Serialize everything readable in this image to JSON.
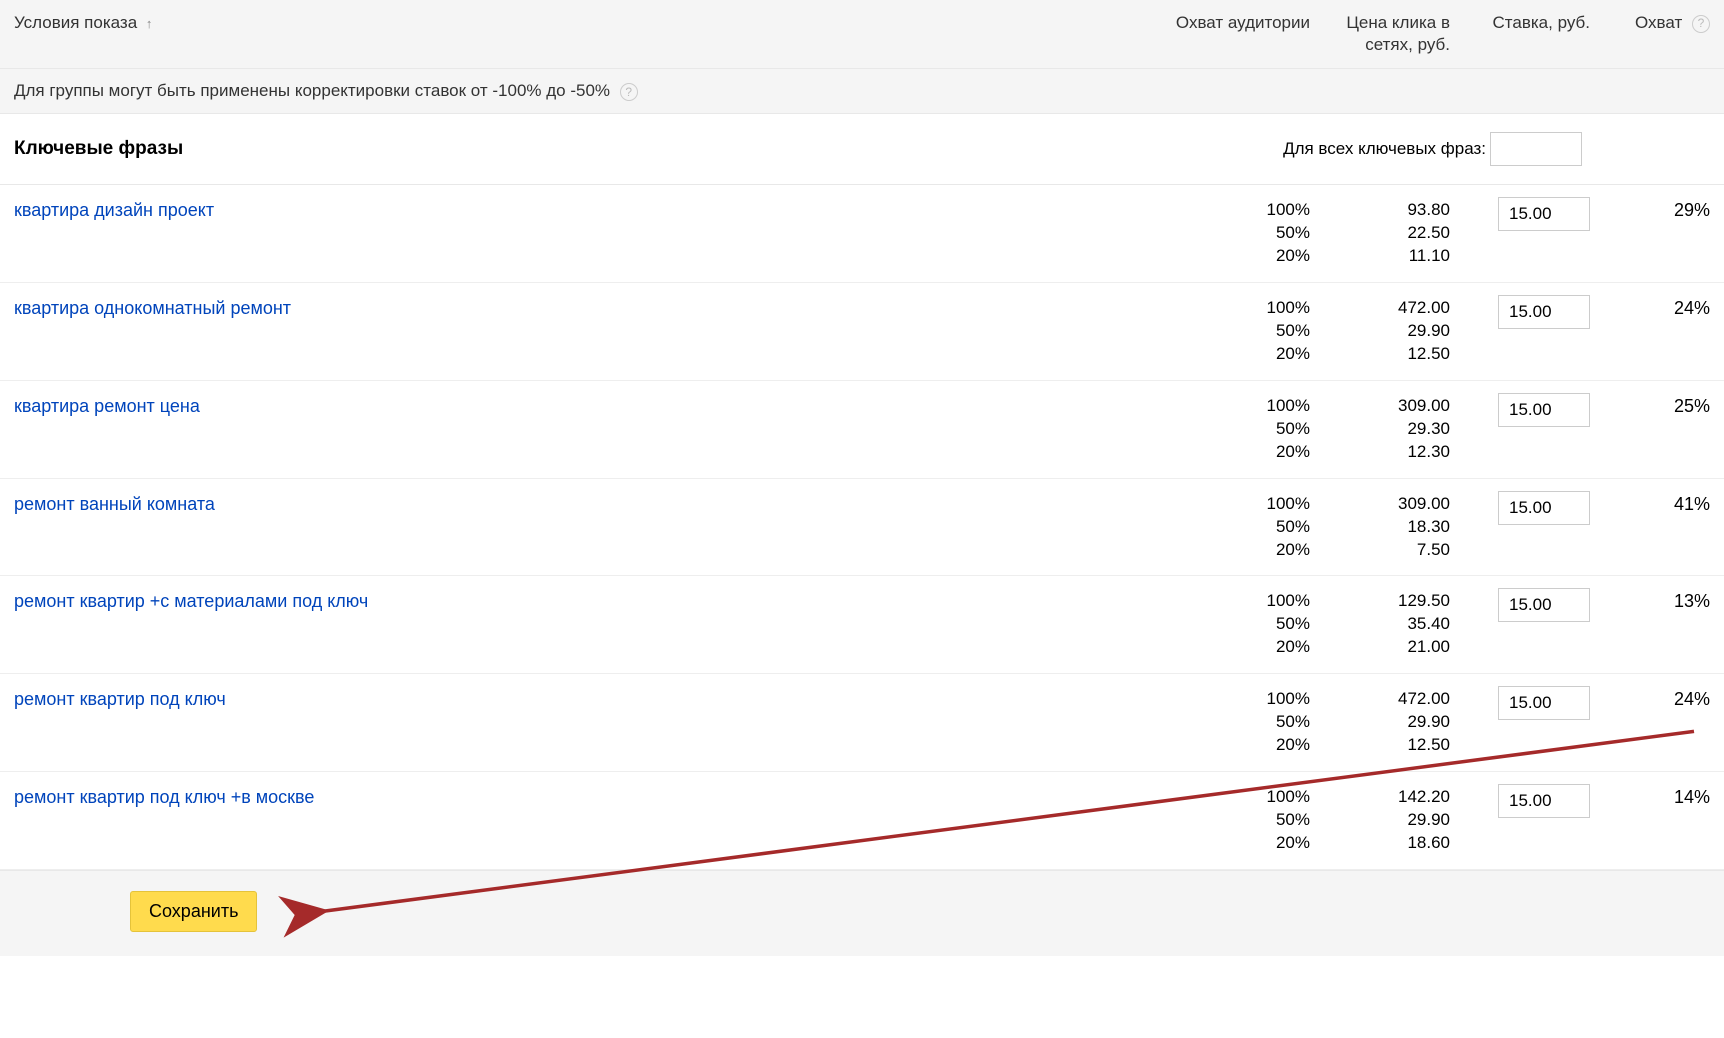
{
  "headers": {
    "conditions": "Условия показа",
    "audience_reach": "Охват аудитории",
    "click_price": "Цена клика в сетях, руб.",
    "bid": "Ставка, руб.",
    "reach": "Охват"
  },
  "correction_notice": "Для группы могут быть применены корректировки ставок от -100% до -50%",
  "section": {
    "title": "Ключевые фразы",
    "all_bids_label": "Для всех ключевых фраз:"
  },
  "rows": [
    {
      "keyword": "квартира дизайн проект",
      "audience": [
        "100%",
        "50%",
        "20%"
      ],
      "price": [
        "93.80",
        "22.50",
        "11.10"
      ],
      "bid": "15.00",
      "reach": "29%"
    },
    {
      "keyword": "квартира однокомнатный ремонт",
      "audience": [
        "100%",
        "50%",
        "20%"
      ],
      "price": [
        "472.00",
        "29.90",
        "12.50"
      ],
      "bid": "15.00",
      "reach": "24%"
    },
    {
      "keyword": "квартира ремонт цена",
      "audience": [
        "100%",
        "50%",
        "20%"
      ],
      "price": [
        "309.00",
        "29.30",
        "12.30"
      ],
      "bid": "15.00",
      "reach": "25%"
    },
    {
      "keyword": "ремонт ванный комната",
      "audience": [
        "100%",
        "50%",
        "20%"
      ],
      "price": [
        "309.00",
        "18.30",
        "7.50"
      ],
      "bid": "15.00",
      "reach": "41%"
    },
    {
      "keyword": "ремонт квартир +с материалами под ключ",
      "audience": [
        "100%",
        "50%",
        "20%"
      ],
      "price": [
        "129.50",
        "35.40",
        "21.00"
      ],
      "bid": "15.00",
      "reach": "13%"
    },
    {
      "keyword": "ремонт квартир под ключ",
      "audience": [
        "100%",
        "50%",
        "20%"
      ],
      "price": [
        "472.00",
        "29.90",
        "12.50"
      ],
      "bid": "15.00",
      "reach": "24%"
    },
    {
      "keyword": "ремонт квартир под ключ +в москве",
      "audience": [
        "100%",
        "50%",
        "20%"
      ],
      "price": [
        "142.20",
        "29.90",
        "18.60"
      ],
      "bid": "15.00",
      "reach": "14%"
    }
  ],
  "footer": {
    "save": "Сохранить"
  },
  "colors": {
    "link": "#0044bb",
    "button_bg": "#ffdb4d",
    "arrow": "#a52a2a"
  }
}
